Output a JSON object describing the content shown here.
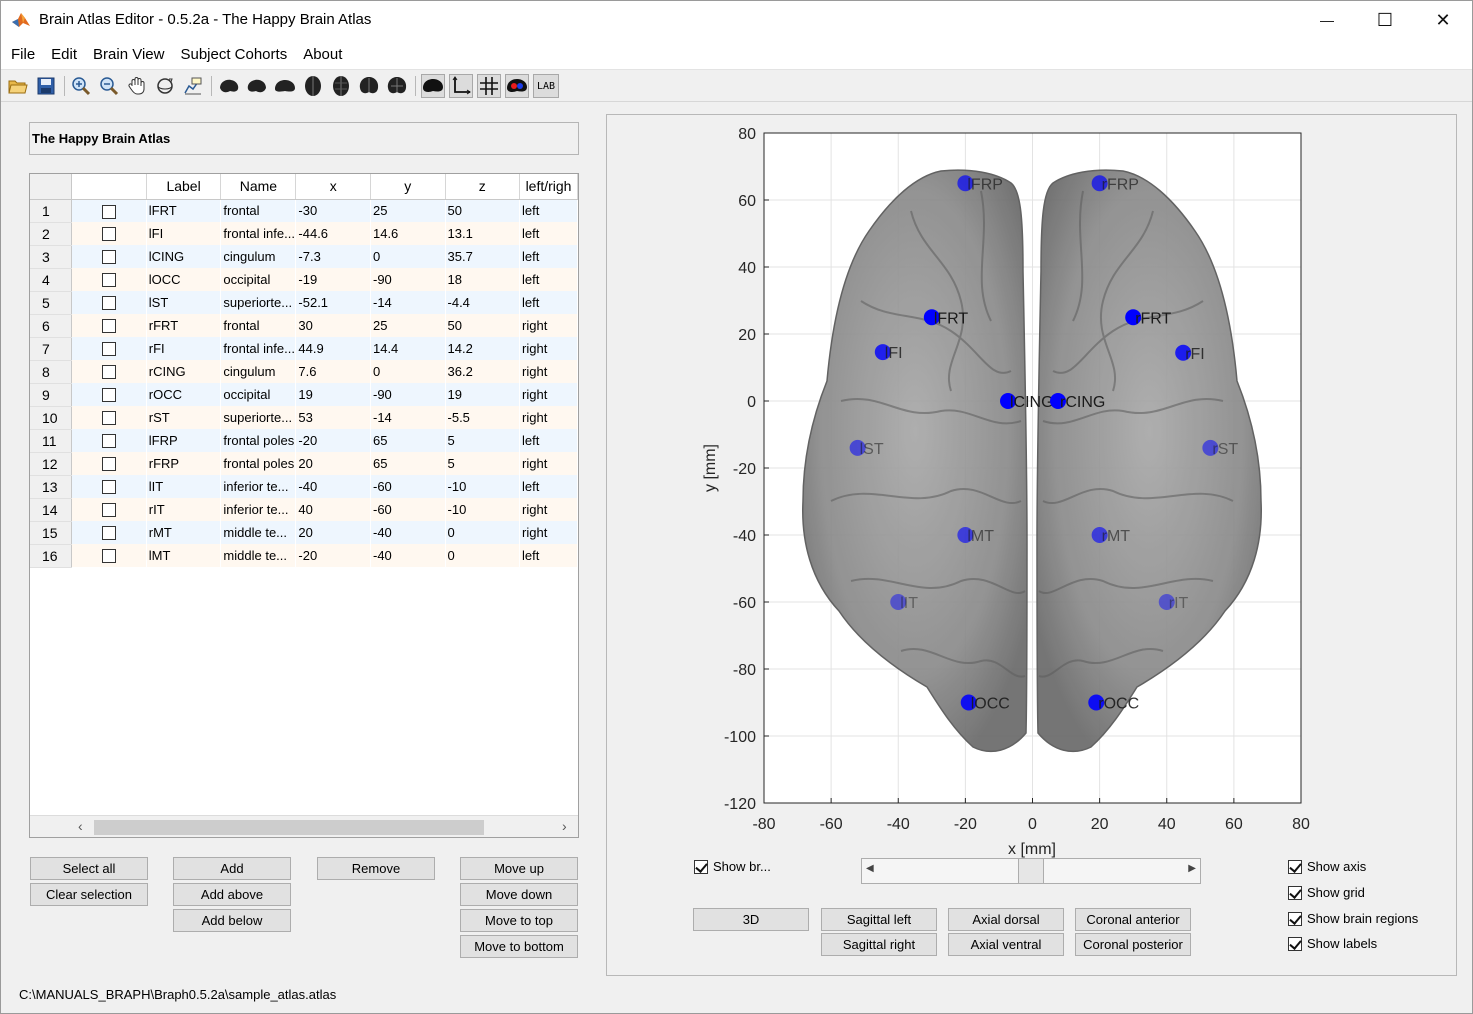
{
  "window": {
    "title": "Brain Atlas Editor - 0.5.2a - The Happy Brain Atlas",
    "minimize_glyph": "—",
    "maximize_glyph": "☐",
    "close_glyph": "✕"
  },
  "menu": [
    "File",
    "Edit",
    "Brain View",
    "Subject Cohorts",
    "About"
  ],
  "toolbar": {
    "icons": [
      "open-icon",
      "save-icon",
      "zoom-in-icon",
      "zoom-out-icon",
      "pan-icon",
      "rotate-3d-icon",
      "data-cursor-icon",
      "brain-sagittal-left-icon",
      "brain-sagittal-right-icon",
      "brain-axial-dorsal-icon",
      "brain-axial-ventral-icon",
      "brain-coronal-anterior-icon",
      "brain-coronal-posterior-icon",
      "brain-lateral-icon",
      "brain-toggle-icon",
      "axis-toggle-icon",
      "grid-toggle-icon",
      "regions-toggle-icon",
      "labels-toggle-icon"
    ],
    "lab_text": "LAB"
  },
  "atlas_name": "The Happy Brain Atlas",
  "table": {
    "headers": [
      "",
      "Label",
      "Name",
      "x",
      "y",
      "z",
      "left/righ"
    ],
    "rows": [
      {
        "n": "1",
        "label": "lFRT",
        "name": "frontal",
        "x": "-30",
        "y": "25",
        "z": "50",
        "lr": "left"
      },
      {
        "n": "2",
        "label": "lFI",
        "name": "frontal infe...",
        "x": "-44.6",
        "y": "14.6",
        "z": "13.1",
        "lr": "left"
      },
      {
        "n": "3",
        "label": "lCING",
        "name": "cingulum",
        "x": "-7.3",
        "y": "0",
        "z": "35.7",
        "lr": "left"
      },
      {
        "n": "4",
        "label": "lOCC",
        "name": "occipital",
        "x": "-19",
        "y": "-90",
        "z": "18",
        "lr": "left"
      },
      {
        "n": "5",
        "label": "lST",
        "name": "superiorte...",
        "x": "-52.1",
        "y": "-14",
        "z": "-4.4",
        "lr": "left"
      },
      {
        "n": "6",
        "label": "rFRT",
        "name": "frontal",
        "x": "30",
        "y": "25",
        "z": "50",
        "lr": "right"
      },
      {
        "n": "7",
        "label": "rFI",
        "name": "frontal infe...",
        "x": "44.9",
        "y": "14.4",
        "z": "14.2",
        "lr": "right"
      },
      {
        "n": "8",
        "label": "rCING",
        "name": "cingulum",
        "x": "7.6",
        "y": "0",
        "z": "36.2",
        "lr": "right"
      },
      {
        "n": "9",
        "label": "rOCC",
        "name": "occipital",
        "x": "19",
        "y": "-90",
        "z": "19",
        "lr": "right"
      },
      {
        "n": "10",
        "label": "rST",
        "name": "superiorte...",
        "x": "53",
        "y": "-14",
        "z": "-5.5",
        "lr": "right"
      },
      {
        "n": "11",
        "label": "lFRP",
        "name": "frontal poles",
        "x": "-20",
        "y": "65",
        "z": "5",
        "lr": "left"
      },
      {
        "n": "12",
        "label": "rFRP",
        "name": "frontal poles",
        "x": "20",
        "y": "65",
        "z": "5",
        "lr": "right"
      },
      {
        "n": "13",
        "label": "lIT",
        "name": "inferior te...",
        "x": "-40",
        "y": "-60",
        "z": "-10",
        "lr": "left"
      },
      {
        "n": "14",
        "label": "rIT",
        "name": "inferior te...",
        "x": "40",
        "y": "-60",
        "z": "-10",
        "lr": "right"
      },
      {
        "n": "15",
        "label": "rMT",
        "name": "middle te...",
        "x": "20",
        "y": "-40",
        "z": "0",
        "lr": "right"
      },
      {
        "n": "16",
        "label": "lMT",
        "name": "middle te...",
        "x": "-20",
        "y": "-40",
        "z": "0",
        "lr": "left"
      }
    ]
  },
  "buttons": {
    "select_all": "Select all",
    "clear_selection": "Clear selection",
    "add": "Add",
    "add_above": "Add above",
    "add_below": "Add below",
    "remove": "Remove",
    "move_up": "Move up",
    "move_down": "Move down",
    "move_to_top": "Move to top",
    "move_to_bottom": "Move to bottom",
    "view_3d": "3D",
    "sagittal_left": "Sagittal left",
    "sagittal_right": "Sagittal right",
    "axial_dorsal": "Axial dorsal",
    "axial_ventral": "Axial ventral",
    "coronal_anterior": "Coronal anterior",
    "coronal_posterior": "Coronal posterior"
  },
  "checkboxes": {
    "show_brain": {
      "label": "Show br...",
      "checked": true
    },
    "show_axis": {
      "label": "Show axis",
      "checked": true
    },
    "show_grid": {
      "label": "Show grid",
      "checked": true
    },
    "show_brain_regions": {
      "label": "Show brain regions",
      "checked": true
    },
    "show_labels": {
      "label": "Show labels",
      "checked": true
    }
  },
  "slider": {
    "value_fraction": 0.5
  },
  "plot": {
    "xlabel": "x [mm]",
    "ylabel": "y [mm]",
    "xlim": [
      -80,
      80
    ],
    "ylim": [
      -120,
      80
    ],
    "xticks": [
      "-80",
      "-60",
      "-40",
      "-20",
      "0",
      "20",
      "40",
      "60",
      "80"
    ],
    "yticks": [
      "80",
      "60",
      "40",
      "20",
      "0",
      "-20",
      "-40",
      "-60",
      "-80",
      "-100",
      "-120"
    ],
    "grid": true,
    "marker_color": "#0000ff",
    "regions": [
      {
        "label": "lFRT",
        "x": -30,
        "y": 25,
        "z": 50
      },
      {
        "label": "lFI",
        "x": -44.6,
        "y": 14.6,
        "z": 13.1
      },
      {
        "label": "lCING",
        "x": -7.3,
        "y": 0,
        "z": 35.7
      },
      {
        "label": "lOCC",
        "x": -19,
        "y": -90,
        "z": 18
      },
      {
        "label": "lST",
        "x": -52.1,
        "y": -14,
        "z": -4.4
      },
      {
        "label": "rFRT",
        "x": 30,
        "y": 25,
        "z": 50
      },
      {
        "label": "rFI",
        "x": 44.9,
        "y": 14.4,
        "z": 14.2
      },
      {
        "label": "rCING",
        "x": 7.6,
        "y": 0,
        "z": 36.2
      },
      {
        "label": "rOCC",
        "x": 19,
        "y": -90,
        "z": 19
      },
      {
        "label": "rST",
        "x": 53,
        "y": -14,
        "z": -5.5
      },
      {
        "label": "lFRP",
        "x": -20,
        "y": 65,
        "z": 5
      },
      {
        "label": "rFRP",
        "x": 20,
        "y": 65,
        "z": 5
      },
      {
        "label": "lIT",
        "x": -40,
        "y": -60,
        "z": -10
      },
      {
        "label": "rIT",
        "x": 40,
        "y": -60,
        "z": -10
      },
      {
        "label": "rMT",
        "x": 20,
        "y": -40,
        "z": 0
      },
      {
        "label": "lMT",
        "x": -20,
        "y": -40,
        "z": 0
      }
    ]
  },
  "status_path": "C:\\MANUALS_BRAPH\\Braph0.5.2a\\sample_atlas.atlas"
}
